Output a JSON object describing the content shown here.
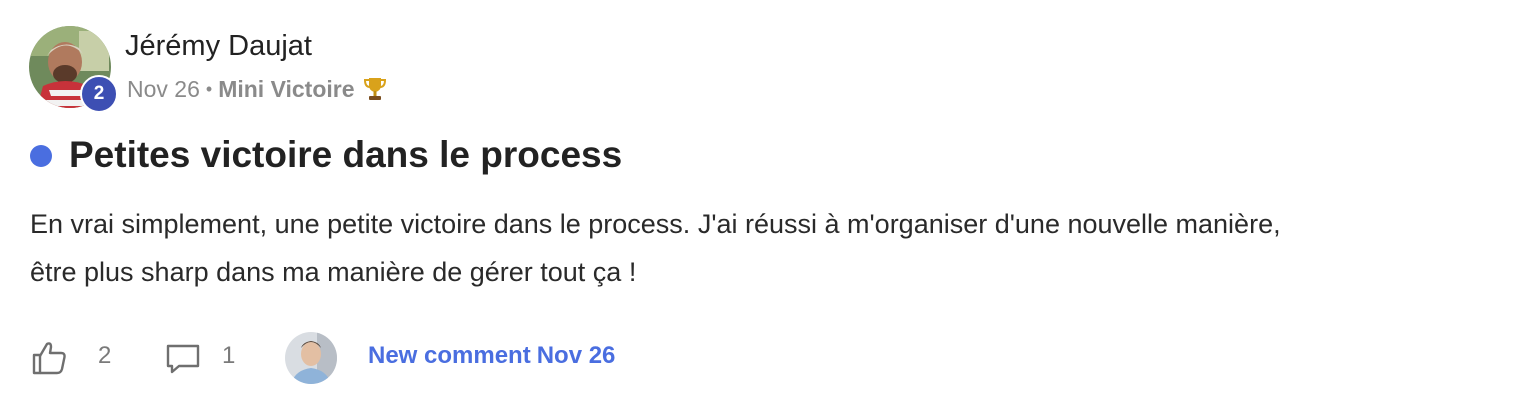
{
  "post": {
    "author": {
      "name": "Jérémy Daujat",
      "level": "2"
    },
    "date": "Nov 26",
    "meta_separator": "•",
    "category": "Mini Victoire",
    "category_icon": "trophy-icon",
    "title": "Petites victoire dans le process",
    "unread_color": "#4a6ee0",
    "body_lines": [
      "En vrai simplement, une petite victoire dans le process. J'ai réussi à m'organiser d'une nouvelle manière,",
      "être plus sharp dans ma manière de gérer tout ça !"
    ]
  },
  "footer": {
    "likes": "2",
    "comments": "1",
    "new_comment_label": "New comment",
    "new_comment_date": "Nov 26",
    "accent_color": "#4a6ee0"
  }
}
